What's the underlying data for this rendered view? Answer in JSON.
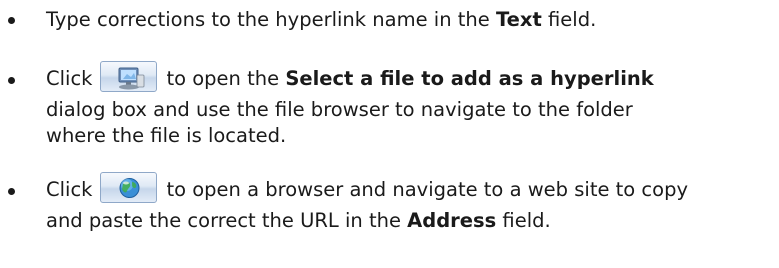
{
  "bullets": [
    {
      "text_before": "Type corrections to the hyperlink name in the ",
      "bold_1": "Text",
      "text_after": " field."
    },
    {
      "line1_prefix": "Click",
      "icon": "computer-icon",
      "line1_middle": "to open the ",
      "bold_1": "Select a file to add as a hyperlink",
      "line2": "dialog box and use the file browser to navigate to the folder",
      "line3": "where the file is located."
    },
    {
      "line1_prefix": "Click",
      "icon": "globe-icon",
      "line1_middle": "to open a browser and navigate to a web site to copy",
      "line2_before": "and paste the correct the URL in the ",
      "bold_1": "Address",
      "line2_after": " field."
    }
  ]
}
